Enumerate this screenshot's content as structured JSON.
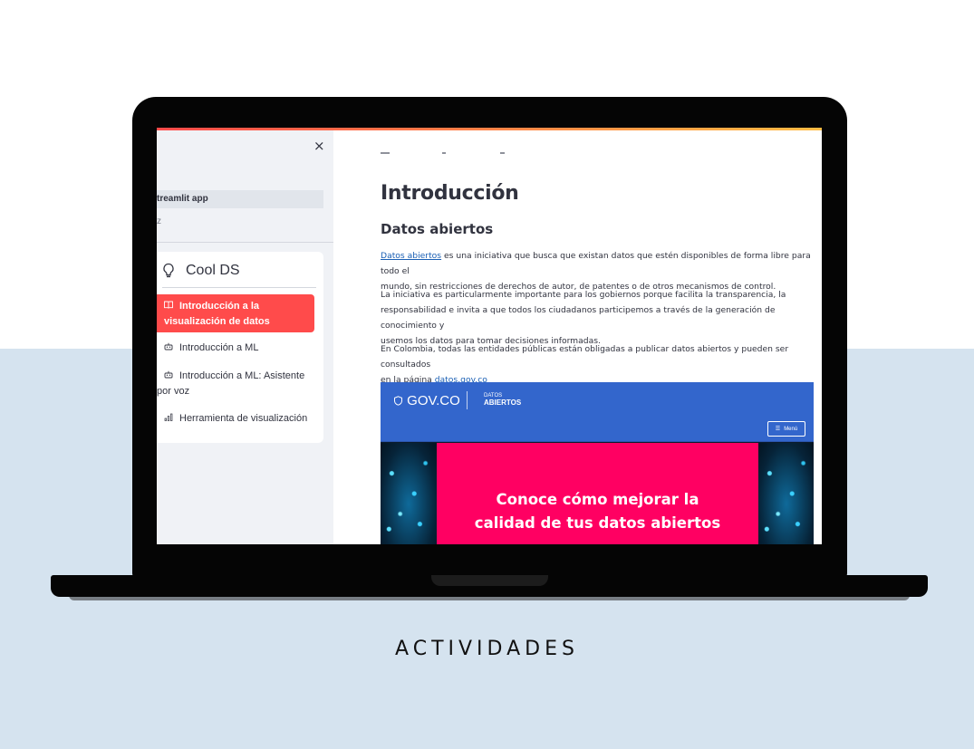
{
  "caption": "ACTIVIDADES",
  "sidebar": {
    "close_glyph": "×",
    "app_name": "treamlit app",
    "app_sub": "z",
    "menu": {
      "title": "Cool DS",
      "title_icon": "lightbulb-icon",
      "items": [
        {
          "label_1": "Introducción a la",
          "label_2": "visualización de datos",
          "icon": "book-icon",
          "active": true
        },
        {
          "label": "Introducción a ML",
          "icon": "robot-icon",
          "active": false
        },
        {
          "label_1": "Introducción a ML: Asistente",
          "label_2": "por voz",
          "icon": "robot-icon",
          "active": false
        },
        {
          "label": "Herramienta de visualización",
          "icon": "bar-chart-icon",
          "active": false
        }
      ]
    }
  },
  "main": {
    "title": "Introducción",
    "subtitle": "Datos abiertos",
    "p1_link": "Datos abiertos",
    "p1_text_a": " es una iniciativa que busca que existan datos que estén disponibles de forma libre para todo el",
    "p1_text_b": "mundo, sin restricciones de derechos de autor, de patentes o de otros mecanismos de control.",
    "p2_line1": "La iniciativa es particularmente importante para los gobiernos porque facilita la transparencia, la",
    "p2_line2": "responsabilidad e invita a que todos los ciudadanos participemos a través de la generación de conocimiento y",
    "p2_line3": "usemos los datos para tomar decisiones informadas.",
    "p3_line1": "En Colombia, todas las entidades públicas están obligadas a publicar datos abiertos y pueden ser consultados",
    "p3_text": "en la página ",
    "p3_link": "datos.gov.co"
  },
  "banner": {
    "gov_logo": "GOV.CO",
    "datos_small": "DATOS",
    "datos_big": "ABIERTOS",
    "menu_label": "Menú",
    "headline_1": "Conoce cómo mejorar la",
    "headline_2": "calidad de tus datos abiertos"
  }
}
